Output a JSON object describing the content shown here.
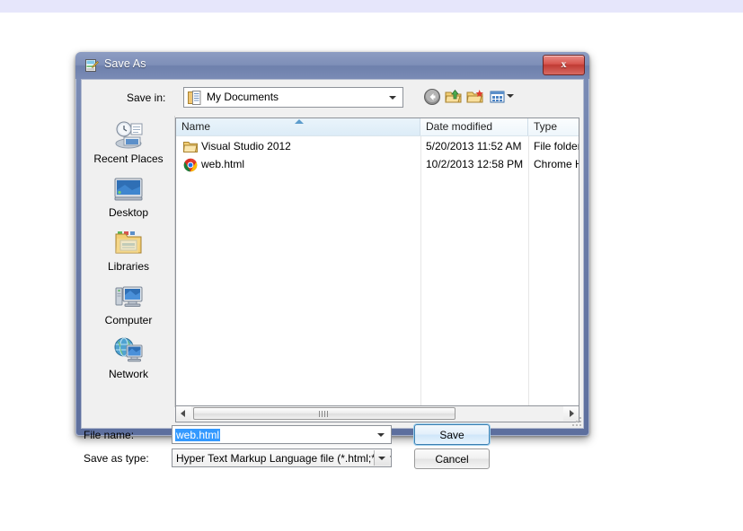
{
  "window": {
    "title": "Save As",
    "title_icon": "notepad-document-icon",
    "close_label": "x"
  },
  "toolbar": {
    "save_in_label": "Save in:",
    "save_in_value": "My Documents",
    "save_in_icon": "folder-documents-icon",
    "buttons": [
      {
        "name": "back-icon",
        "label": "Back"
      },
      {
        "name": "up-folder-icon",
        "label": "Up One Level"
      },
      {
        "name": "new-folder-icon",
        "label": "Create New Folder"
      },
      {
        "name": "views-icon",
        "label": "Views"
      }
    ]
  },
  "places": [
    {
      "label": "Recent Places",
      "icon": "recent-places-icon"
    },
    {
      "label": "Desktop",
      "icon": "desktop-icon"
    },
    {
      "label": "Libraries",
      "icon": "libraries-icon"
    },
    {
      "label": "Computer",
      "icon": "computer-icon"
    },
    {
      "label": "Network",
      "icon": "network-icon"
    }
  ],
  "file_list": {
    "columns": [
      "Name",
      "Date modified",
      "Type"
    ],
    "sort_column": "Name",
    "rows": [
      {
        "name": "Visual Studio 2012",
        "date_modified": "5/20/2013 11:52 AM",
        "type": "File folder",
        "icon": "folder-icon"
      },
      {
        "name": "web.html",
        "date_modified": "10/2/2013 12:58 PM",
        "type": "Chrome H",
        "icon": "chrome-icon"
      }
    ]
  },
  "form": {
    "filename_label": "File name:",
    "filename_value": "web.html",
    "savetype_label": "Save as type:",
    "savetype_value": "Hyper Text Markup Language file (*.html;*.htm;*",
    "save_button": "Save",
    "cancel_button": "Cancel"
  },
  "colors": {
    "accent": "#3399ff",
    "frame": "#6e80ac",
    "close_red": "#c03b34",
    "default_button_border": "#3c7fb1"
  }
}
